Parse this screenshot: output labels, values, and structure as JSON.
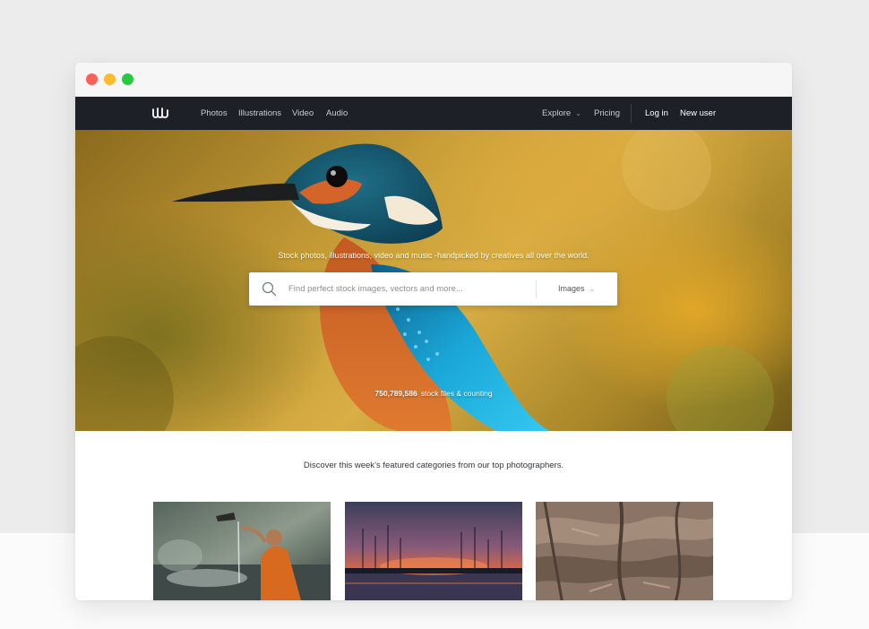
{
  "nav": {
    "links_left": [
      "Photos",
      "Illustrations",
      "Video",
      "Audio"
    ],
    "explore": "Explore",
    "pricing": "Pricing",
    "login": "Log in",
    "new_user": "New user"
  },
  "hero": {
    "tagline": "Stock photos, illustrations, video and music -handpicked by creatives all over the world.",
    "search_placeholder": "Find perfect stock images, vectors and more...",
    "search_type": "Images",
    "count_number": "750,789,586",
    "count_text": "stock files & counting"
  },
  "featured": {
    "text": "Discover this week’s featured categories from our top photographers."
  },
  "colors": {
    "navbar": "#1d2127",
    "hero_yellow": "#d9ae45",
    "kingfisher_blue": "#1aa7d8",
    "kingfisher_orange": "#d4642a"
  },
  "icons": {
    "logo": "wave-logo-icon",
    "search": "search-icon",
    "dropdown": "chevron-down-icon"
  }
}
